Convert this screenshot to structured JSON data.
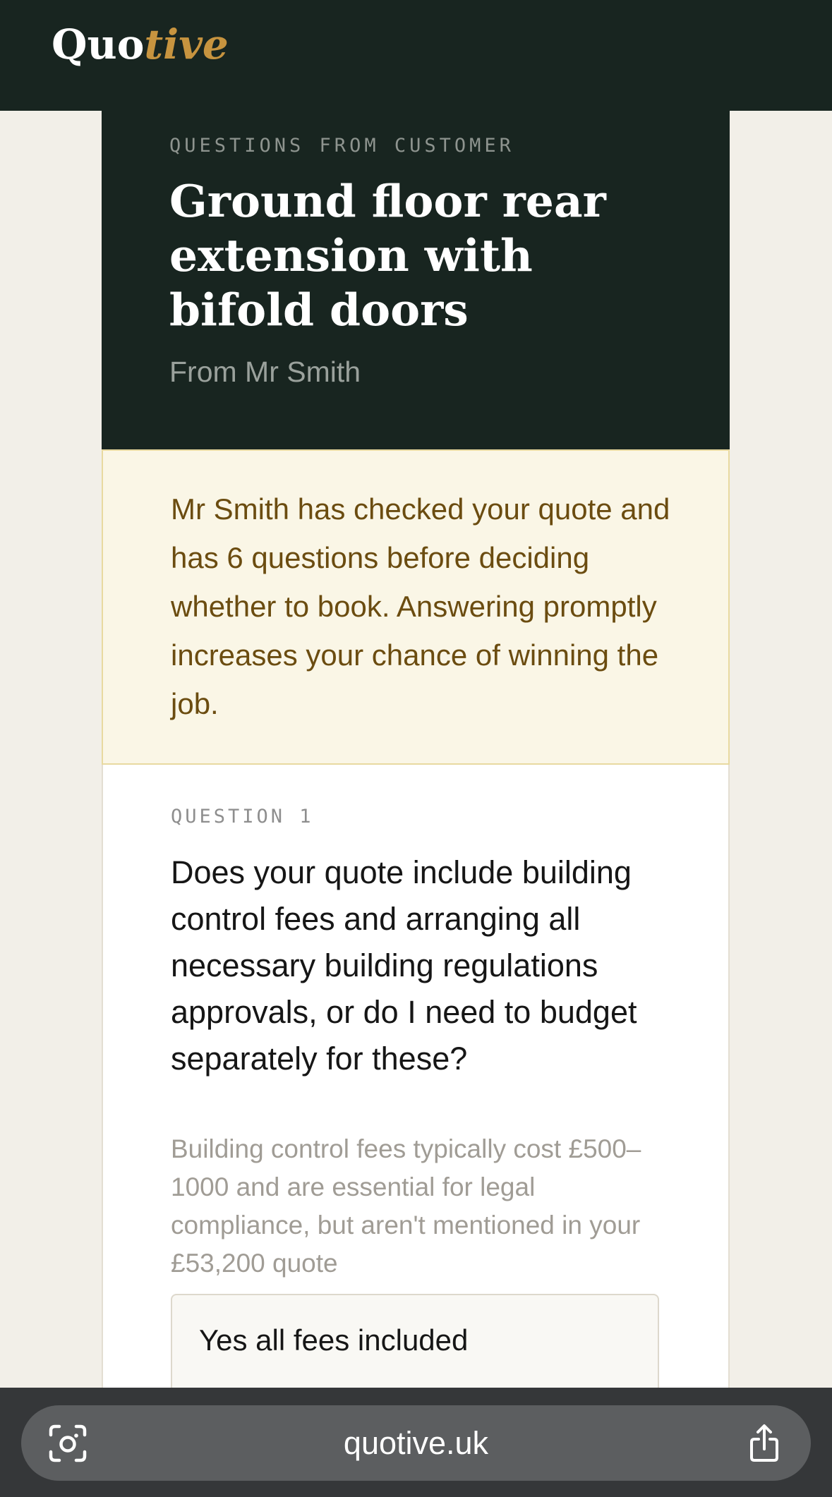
{
  "header": {
    "logo_main": "Quo",
    "logo_accent": "tive"
  },
  "hero": {
    "eyebrow": "QUESTIONS FROM CUSTOMER",
    "title": "Ground floor rear extension with bifold doors",
    "subtitle": "From Mr Smith"
  },
  "notice": {
    "text": "Mr Smith has checked your quote and has 6 questions before deciding whether to book. Answering promptly increases your chance of winning the job."
  },
  "question": {
    "label": "QUESTION 1",
    "text": "Does your quote include building control fees and arranging all necessary building regulations approvals, or do I need to budget separately for these?",
    "note": "Building control fees typically cost £500–1000 and are essential for legal compliance, but aren't mentioned in your £53,200 quote",
    "options": [
      {
        "label": "Yes all fees included"
      }
    ]
  },
  "browser": {
    "url": "quotive.uk",
    "left_icon": "visual-lookup-icon",
    "right_icon": "share-icon"
  },
  "colors": {
    "brand_dark": "#182520",
    "brand_accent": "#c7943f",
    "notice_bg": "#faf6e6",
    "notice_text": "#6b4c10"
  }
}
